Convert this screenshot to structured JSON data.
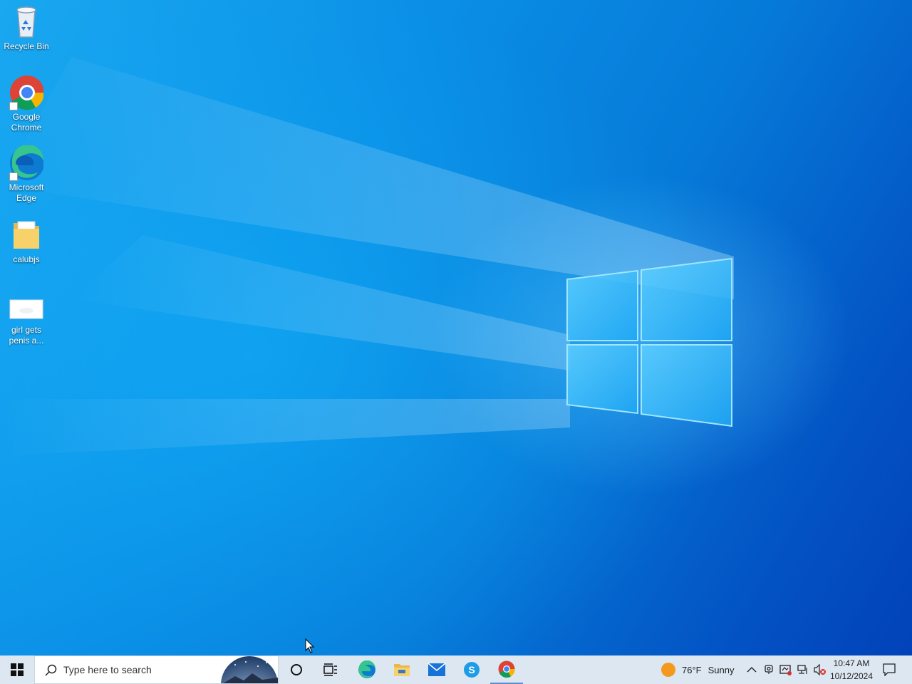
{
  "desktop": {
    "icons": [
      {
        "label": "Recycle Bin"
      },
      {
        "label": "Google Chrome"
      },
      {
        "label": "Microsoft Edge"
      },
      {
        "label": "calubjs"
      },
      {
        "label": "girl gets penis a..."
      }
    ]
  },
  "taskbar": {
    "search_placeholder": "Type here to search",
    "pinned": [
      "task-view",
      "microsoft-edge",
      "file-explorer",
      "mail",
      "skype",
      "google-chrome"
    ],
    "weather": {
      "temp": "76°F",
      "condition": "Sunny"
    },
    "clock": {
      "time": "10:47 AM",
      "date": "10/12/2024"
    }
  },
  "colors": {
    "taskbar_bg": "#dde7f2",
    "desktop_accent": "#0a8ee6"
  }
}
